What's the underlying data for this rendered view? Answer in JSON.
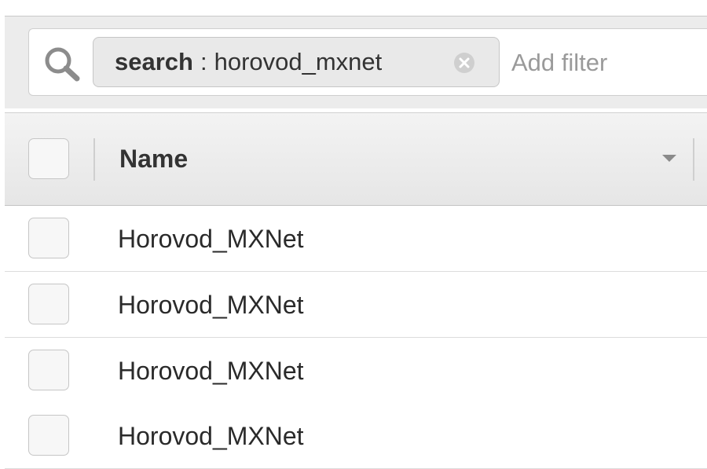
{
  "filter_bar": {
    "token_key": "search",
    "token_separator": ":",
    "token_value": "horovod_mxnet",
    "add_filter_placeholder": "Add filter"
  },
  "table": {
    "columns": [
      "Name"
    ],
    "rows": [
      {
        "name": "Horovod_MXNet"
      },
      {
        "name": "Horovod_MXNet"
      },
      {
        "name": "Horovod_MXNet"
      },
      {
        "name": "Horovod_MXNet"
      }
    ]
  },
  "icons": {
    "search": "search-icon",
    "remove_token": "close-circle-icon",
    "sort": "caret-down-icon"
  }
}
